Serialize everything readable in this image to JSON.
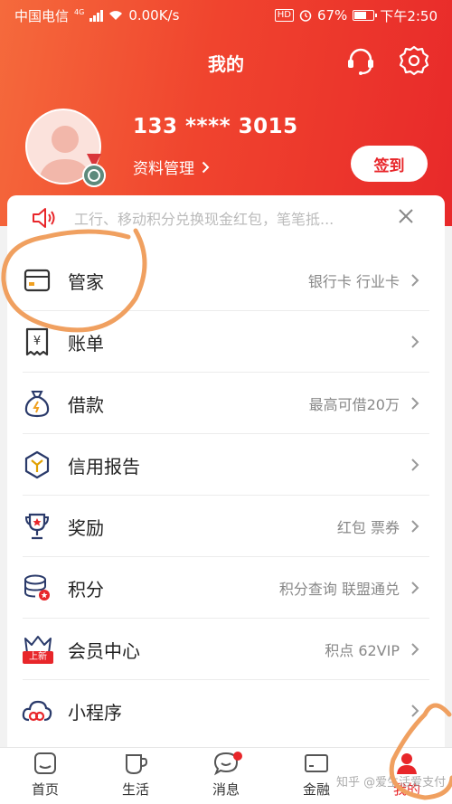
{
  "status_bar": {
    "carrier": "中国电信",
    "network_tag": "4G",
    "speed": "0.00K/s",
    "hd": "HD",
    "battery": "67%",
    "battery_level": 0.67,
    "time": "下午2:50"
  },
  "header": {
    "title": "我的",
    "phone": "133 **** 3015",
    "profile_link": "资料管理",
    "signin_label": "签到"
  },
  "notice": {
    "text": "工行、移动积分兑换现金红包，笔笔抵..."
  },
  "menu": [
    {
      "label": "管家",
      "sub": "银行卡 行业卡",
      "icon": "card-icon"
    },
    {
      "label": "账单",
      "sub": "",
      "icon": "bill-icon"
    },
    {
      "label": "借款",
      "sub": "最高可借20万",
      "icon": "money-bag-icon"
    },
    {
      "label": "信用报告",
      "sub": "",
      "icon": "credit-report-icon"
    },
    {
      "label": "奖励",
      "sub": "红包 票券",
      "icon": "trophy-icon"
    },
    {
      "label": "积分",
      "sub": "积分查询 联盟通兑",
      "icon": "points-icon"
    },
    {
      "label": "会员中心",
      "sub": "积点 62VIP",
      "icon": "vip-crown-icon",
      "badge": "上新"
    },
    {
      "label": "小程序",
      "sub": "",
      "icon": "mini-program-icon"
    }
  ],
  "tabs": [
    {
      "label": "首页",
      "icon": "home-icon"
    },
    {
      "label": "生活",
      "icon": "life-icon"
    },
    {
      "label": "消息",
      "icon": "message-icon"
    },
    {
      "label": "金融",
      "icon": "finance-icon"
    },
    {
      "label": "我的",
      "icon": "profile-icon"
    }
  ],
  "watermark": "知乎 @爱生活爱支付",
  "colors": {
    "brand_red": "#e8262a",
    "header_gradient_start": "#f56a3c",
    "annotation_orange": "#f0a060"
  }
}
